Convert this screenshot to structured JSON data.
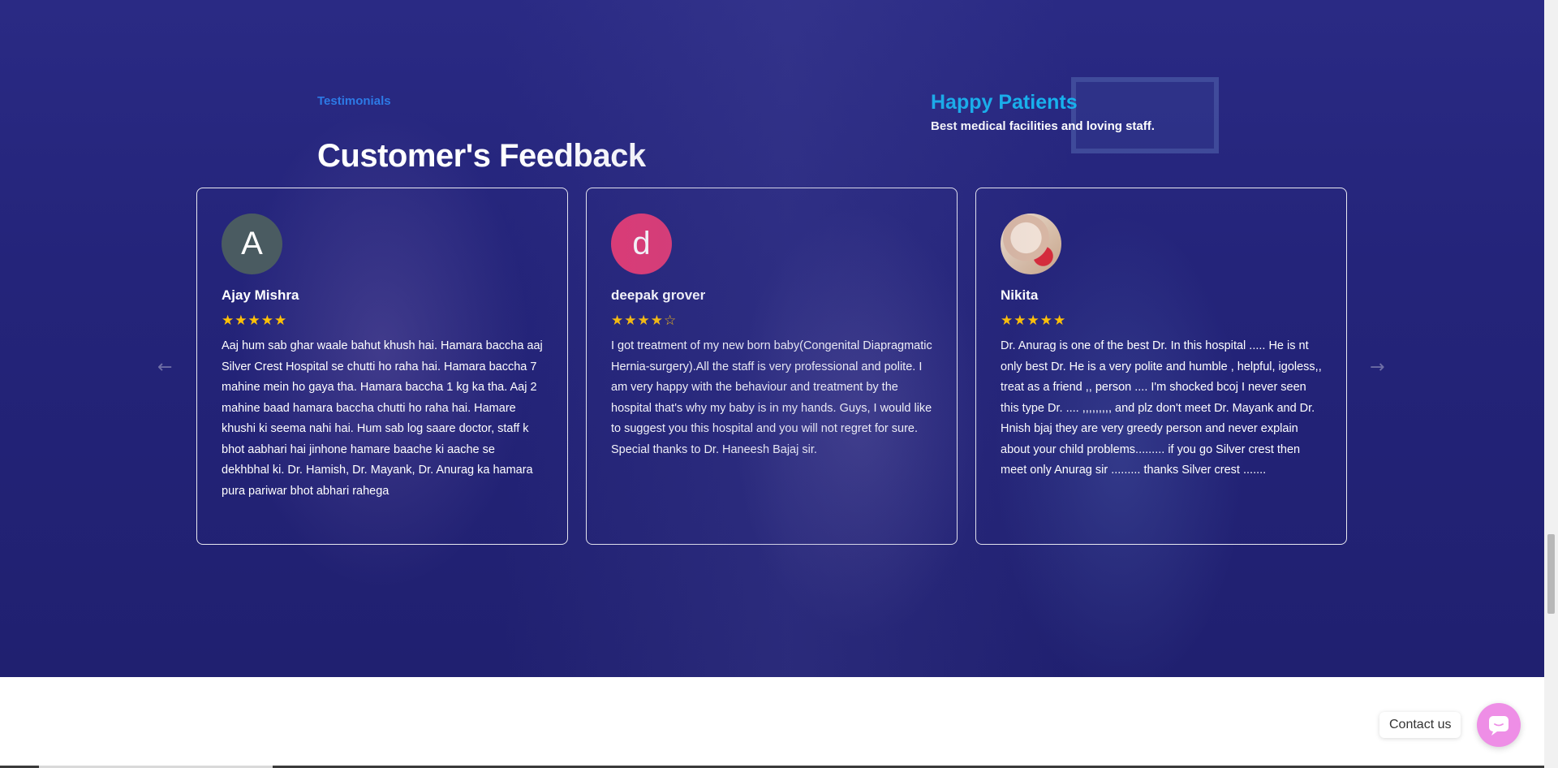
{
  "section": {
    "eyebrow": "Testimonials",
    "title": "Customer's Feedback",
    "side_title": "Happy Patients",
    "side_subtitle": "Best medical facilities and loving staff."
  },
  "reviews": [
    {
      "avatar_letter": "A",
      "avatar_color": "#4a5b61",
      "name": "Ajay Mishra",
      "stars": "★★★★★",
      "rating": 5,
      "text": "Aaj hum sab ghar waale bahut khush hai. Hamara baccha aaj Silver Crest Hospital se chutti ho raha hai. Hamara baccha 7 mahine mein ho gaya tha. Hamara baccha 1 kg ka tha. Aaj 2 mahine baad hamara baccha chutti ho raha hai. Hamare khushi ki seema nahi hai. Hum sab log saare doctor, staff k bhot aabhari hai jinhone hamare baache ki aache se dekhbhal ki. Dr. Hamish, Dr. Mayank, Dr. Anurag ka hamara pura pariwar bhot abhari rahega"
    },
    {
      "avatar_letter": "d",
      "avatar_color": "#e23a73",
      "name": "deepak grover",
      "stars": "★★★★☆",
      "rating": 4,
      "text": "I got treatment of my new born baby(Congenital Diapragmatic Hernia-surgery).All the staff is very professional and polite. I am very happy with the behaviour and treatment by the hospital that's why my baby is in my hands. Guys, I would like to suggest you this hospital and you will not regret for sure. Special thanks to Dr. Haneesh Bajaj sir."
    },
    {
      "avatar_letter": "",
      "avatar_color": "#e9d5c4",
      "name": "Nikita",
      "stars": "★★★★★",
      "rating": 5,
      "text": "Dr. Anurag is one of the best Dr. In this hospital ..... He is nt only best Dr. He is a very polite and humble , helpful, igoless,, treat as a friend ,, person .... I'm shocked bcoj I never seen this type Dr. .... ,,,,,,,,, and plz don't meet Dr. Mayank and Dr. Hnish bjaj they are very greedy person and never explain about your child problems......... if you go Silver crest then meet only Anurag sir ......... thanks Silver crest ......."
    }
  ],
  "carousel": {
    "prev_icon": "←",
    "next_icon": "→"
  },
  "contact": {
    "label": "Contact us"
  },
  "colors": {
    "eyebrow": "#2d7ae6",
    "side_title": "#17b2ee",
    "stars": "#ffc107",
    "contact_button": "#ee8ee6"
  }
}
